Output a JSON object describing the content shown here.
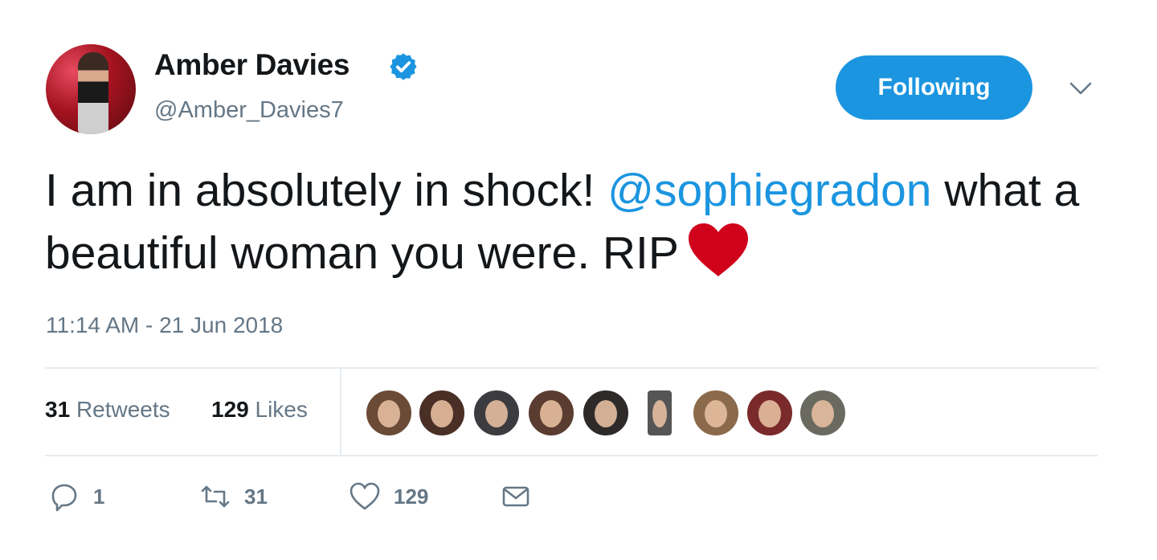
{
  "tweet": {
    "author": {
      "display_name": "Amber Davies",
      "handle": "@Amber_Davies7",
      "verified": true
    },
    "follow_button_label": "Following",
    "text_before": "I am in absolutely in shock! ",
    "mention": "@sophiegradon",
    "text_after": " what a beautiful woman you were. RIP",
    "emoji": "red-heart",
    "timestamp": "11:14 AM - 21 Jun 2018",
    "stats": {
      "retweets_count": "31",
      "retweets_label": "Retweets",
      "likes_count": "129",
      "likes_label": "Likes"
    },
    "liker_avatar_count": 9,
    "actions": {
      "reply_count": "1",
      "retweet_count": "31",
      "like_count": "129"
    }
  },
  "colors": {
    "accent": "#1b95e0",
    "secondary_text": "#657786",
    "heart": "#d0021b"
  },
  "icons": {
    "verified": "verified-badge-icon",
    "more": "chevron-down-icon",
    "reply": "reply-icon",
    "retweet": "retweet-icon",
    "like": "heart-outline-icon",
    "dm": "envelope-icon"
  }
}
